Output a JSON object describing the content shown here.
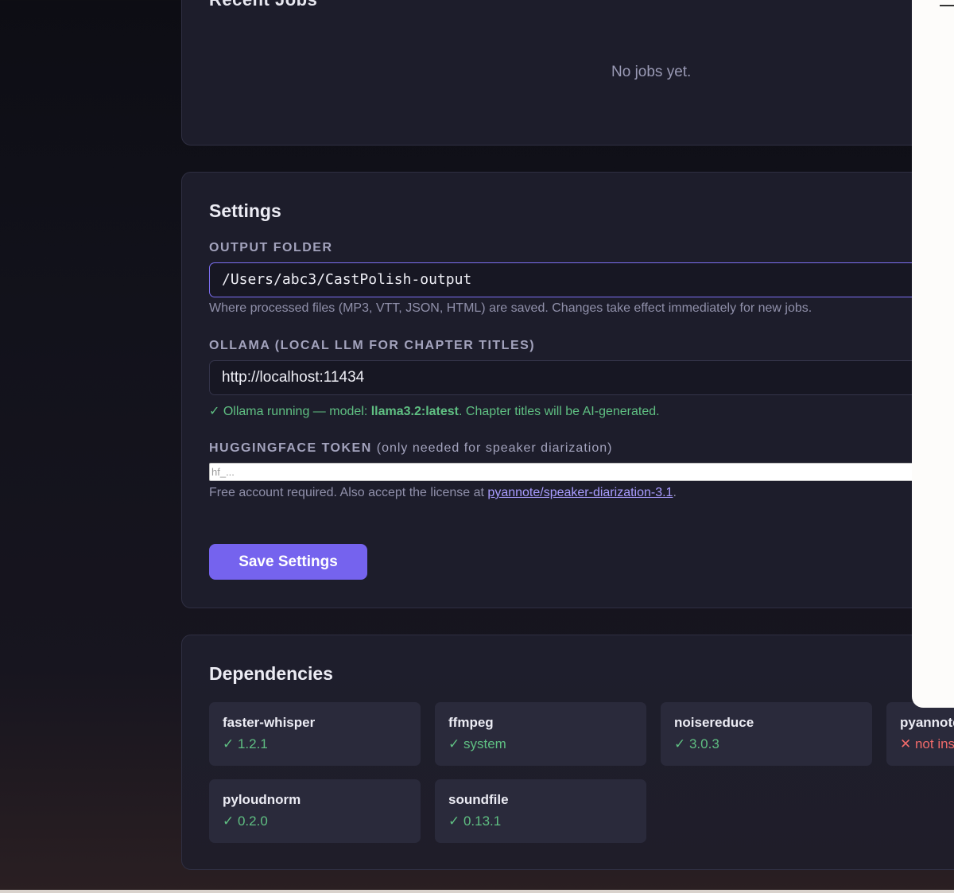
{
  "recent_jobs": {
    "title": "Recent Jobs",
    "empty_text": "No jobs yet."
  },
  "settings": {
    "title": "Settings",
    "output_folder": {
      "label": "OUTPUT FOLDER",
      "value": "/Users/abc3/CastPolish-output",
      "hint": "Where processed files (MP3, VTT, JSON, HTML) are saved. Changes take effect immediately for new jobs."
    },
    "ollama": {
      "label": "OLLAMA (LOCAL LLM FOR CHAPTER TITLES)",
      "value": "http://localhost:11434",
      "status_prefix": "✓ Ollama running — model: ",
      "status_model": "llama3.2:latest",
      "status_suffix": ". Chapter titles will be AI-generated."
    },
    "hf_token": {
      "label": "HUGGINGFACE TOKEN",
      "label_note": "(only needed for speaker diarization)",
      "placeholder": "hf_...",
      "hint_prefix": "Free account required. Also accept the license at ",
      "hint_link": "pyannote/speaker-diarization-3.1",
      "hint_suffix": "."
    },
    "save_label": "Save Settings"
  },
  "dependencies": {
    "title": "Dependencies",
    "items": [
      {
        "name": "faster-whisper",
        "status": "✓ 1.2.1"
      },
      {
        "name": "ffmpeg",
        "status": "✓ system"
      },
      {
        "name": "noisereduce",
        "status": "✓ 3.0.3"
      },
      {
        "name": "pyannote",
        "status": "✕ not ins"
      },
      {
        "name": "pyloudnorm",
        "status": "✓ 0.2.0"
      },
      {
        "name": "soundfile",
        "status": "✓ 0.13.1"
      }
    ]
  },
  "colors": {
    "accent": "#7563ee",
    "ok": "#5fbf82",
    "error": "#f06a6a",
    "card_bg": "#1d1d2b"
  }
}
